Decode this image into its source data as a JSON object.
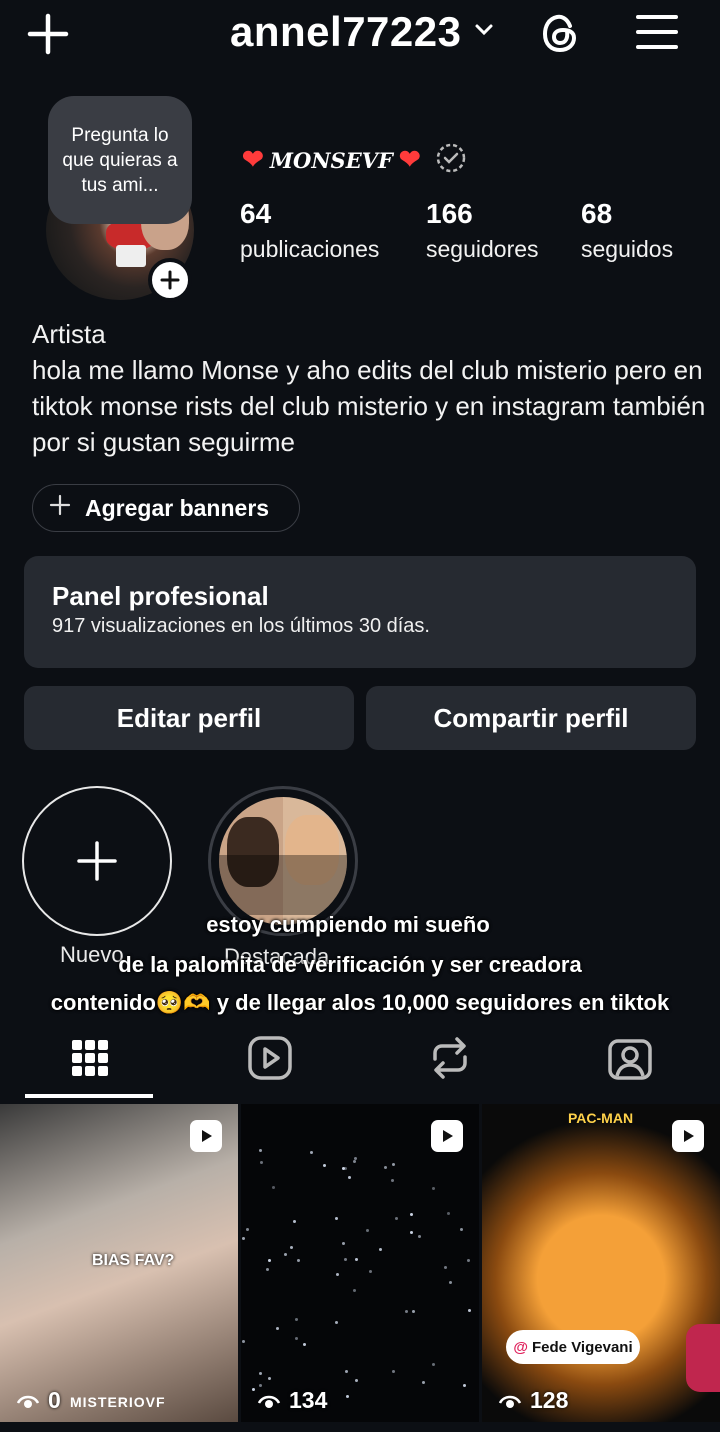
{
  "header": {
    "username": "annel77223",
    "icons": [
      "plus-icon",
      "chevron-down-icon",
      "threads-icon",
      "menu-icon"
    ]
  },
  "profile": {
    "note_bubble": "Pregunta lo que quieras a tus ami...",
    "display_name": "MONSEVF",
    "stats": {
      "posts_count": "64",
      "posts_label": "publicaciones",
      "followers_count": "166",
      "followers_label": "seguidores",
      "following_count": "68",
      "following_label": "seguidos"
    },
    "category": "Artista",
    "bio": "hola me llamo Monse  y aho edits del club misterio pero en tiktok monse rists del club misterio y en instagram también por si gustan seguirme"
  },
  "actions": {
    "banner_label": "Agregar banners",
    "panel_title": "Panel profesional",
    "panel_subtitle": "917 visualizaciones en los últimos 30 días.",
    "edit_profile": "Editar perfil",
    "share_profile": "Compartir perfil"
  },
  "highlights": {
    "new_label": "Nuevo",
    "featured_label": "Destacada"
  },
  "overlay_caption": {
    "line1": "estoy cumpiendo mi  sueño",
    "line2": "de la palomita de verificación y ser creadora",
    "line3": "contenido🥺🫶 y de llegar alos 10,000 seguidores en tiktok"
  },
  "tabs": [
    "grid",
    "reels",
    "reposts",
    "tagged"
  ],
  "posts": [
    {
      "views": "0",
      "overlay_text": "BIAS FAV?",
      "watermark": "MISTERIOVF"
    },
    {
      "views": "134"
    },
    {
      "views": "128",
      "tag": "Fede Vigevani",
      "top_text": "PAC-MAN"
    }
  ]
}
